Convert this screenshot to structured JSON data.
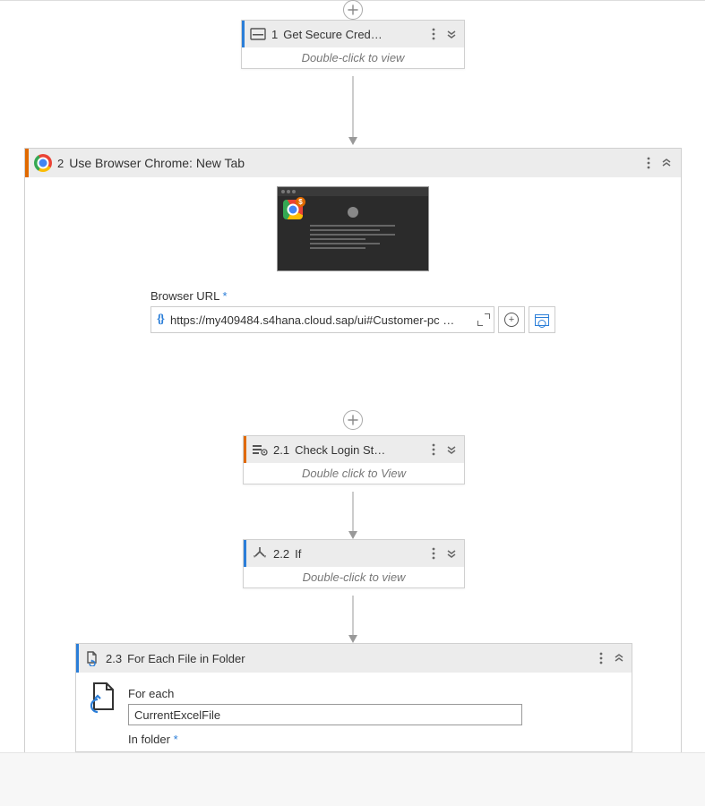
{
  "step1": {
    "number": "1",
    "title": "Get Secure Cred…",
    "hint": "Double-click to view"
  },
  "step2": {
    "number": "2",
    "title": "Use Browser Chrome: New Tab",
    "url_label": "Browser URL",
    "url_required": "*",
    "url_value": "https://my409484.s4hana.cloud.sap/ui#Customer-pc …",
    "thumb_badge": "$"
  },
  "step2_1": {
    "number": "2.1",
    "title": "Check Login St…",
    "hint": "Double click to View"
  },
  "step2_2": {
    "number": "2.2",
    "title": "If",
    "hint": "Double-click to view"
  },
  "step2_3": {
    "number": "2.3",
    "title": "For Each File in Folder",
    "for_each_label": "For each",
    "for_each_value": "CurrentExcelFile",
    "in_folder_label": "In folder",
    "in_folder_required": "*"
  }
}
